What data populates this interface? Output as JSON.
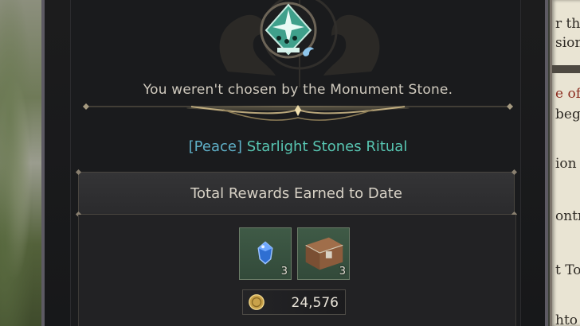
{
  "background": {
    "right_fragments": [
      "r the",
      "siona",
      "e of",
      "beg",
      "ion C",
      "ontr",
      "t To",
      "hto"
    ]
  },
  "dialog": {
    "message": "You weren't chosen by the Monument Stone.",
    "quest_tag": "[Peace]",
    "quest_name": "Starlight Stones Ritual",
    "rewards_header": "Total Rewards Earned to Date",
    "rewards": [
      {
        "item": "blue-gem-icon",
        "count": "3"
      },
      {
        "item": "treasure-chest-icon",
        "count": "3"
      }
    ],
    "currency": {
      "icon": "gold-coin-icon",
      "amount": "24,576"
    }
  },
  "colors": {
    "quest_tag": "#5fb0c8",
    "quest_name": "#58c6b2",
    "slot_bg": "#3f5a46",
    "text_light": "#cfc9bd"
  }
}
